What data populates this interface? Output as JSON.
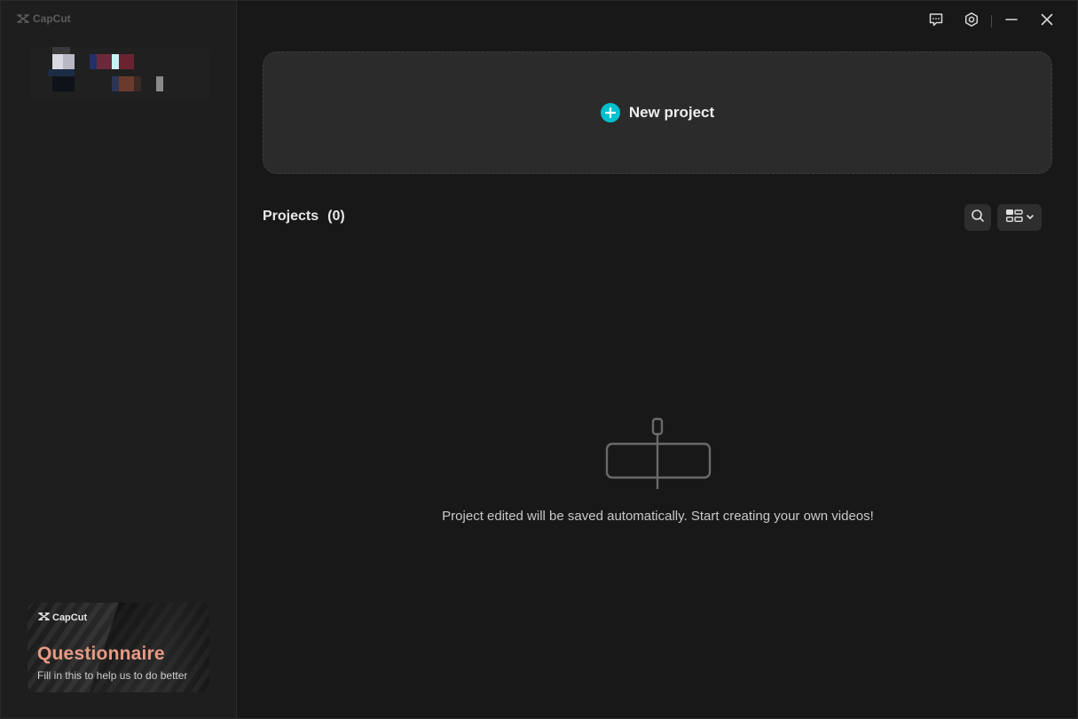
{
  "app": {
    "brand": "CapCut"
  },
  "window_controls": {
    "feedback_icon": "chat-feedback-icon",
    "settings_icon": "settings-icon",
    "minimize_icon": "minimize-icon",
    "close_icon": "close-icon"
  },
  "new_project": {
    "label": "New project",
    "icon": "plus-circle-icon",
    "accent": "#00c1cd"
  },
  "projects": {
    "title": "Projects",
    "count": "(0)",
    "search_icon": "search-icon",
    "view_icon": "grid-view-icon"
  },
  "empty_state": {
    "message": "Project edited will be saved automatically. Start creating your own videos!"
  },
  "questionnaire": {
    "brand": "CapCut",
    "title": "Questionnaire",
    "subtitle": "Fill in this to help us to do better",
    "title_color": "#e79a83"
  }
}
